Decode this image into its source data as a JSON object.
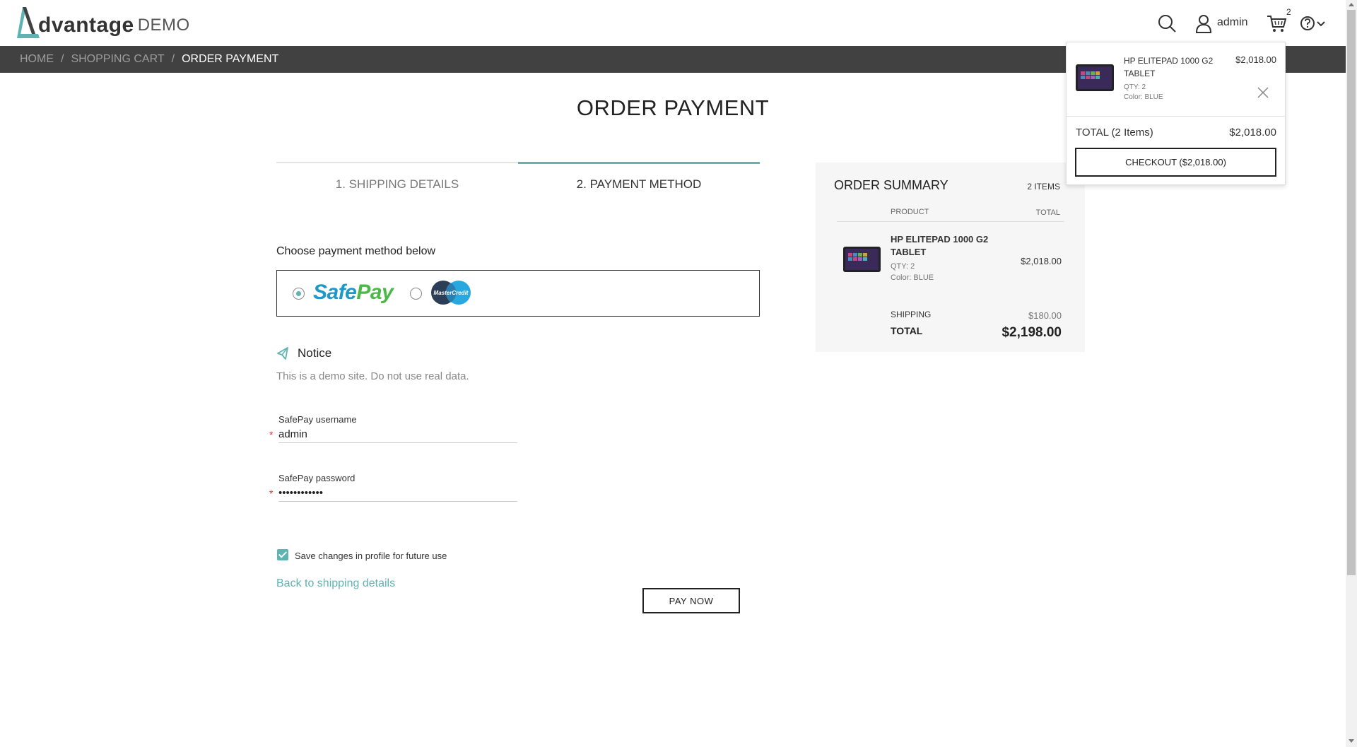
{
  "header": {
    "logo_word": "dvantage",
    "logo_demo": "DEMO",
    "user_label": "admin",
    "cart_count": "2"
  },
  "breadcrumb": {
    "items": [
      "HOME",
      "SHOPPING CART"
    ],
    "current": "ORDER PAYMENT"
  },
  "page": {
    "title": "ORDER PAYMENT"
  },
  "steps": [
    {
      "label": "1. SHIPPING DETAILS",
      "active": false
    },
    {
      "label": "2. PAYMENT METHOD",
      "active": true
    }
  ],
  "payment": {
    "choose_label": "Choose payment method below",
    "methods": [
      {
        "name_part1": "Safe",
        "name_part2": "Pay",
        "selected": true
      },
      {
        "name": "MasterCredit",
        "selected": false
      }
    ]
  },
  "notice": {
    "title": "Notice",
    "text": "This is a demo site. Do not use real data."
  },
  "form": {
    "username_label": "SafePay username",
    "username_value": "admin",
    "password_label": "SafePay password",
    "password_value": "••••••••••••",
    "required_mark": "*",
    "save_label": "Save changes in profile for future use",
    "save_checked": true
  },
  "actions": {
    "back_link": "Back to shipping details",
    "pay_now": "PAY NOW"
  },
  "summary": {
    "title": "ORDER SUMMARY",
    "count": "2 ITEMS",
    "col_product": "PRODUCT",
    "col_total": "TOTAL",
    "item": {
      "name": "HP ELITEPAD 1000 G2 TABLET",
      "qty": "QTY: 2",
      "color": "Color: BLUE",
      "price": "$2,018.00"
    },
    "shipping_label": "SHIPPING",
    "shipping_value": "$180.00",
    "total_label": "TOTAL",
    "total_value": "$2,198.00"
  },
  "cart_popup": {
    "item": {
      "name": "HP ELITEPAD 1000 G2 TABLET",
      "qty": "QTY: 2",
      "color": "Color: BLUE",
      "price": "$2,018.00"
    },
    "total_label": "TOTAL (2 Items)",
    "total_value": "$2,018.00",
    "checkout_label": "CHECKOUT ($2,018.00)"
  },
  "colors": {
    "accent": "#5fb3b3",
    "breadcrumb_bg": "#414141",
    "safepay_blue": "#1f97c8",
    "safepay_green": "#4bb848"
  },
  "icons": [
    "search-icon",
    "user-icon",
    "cart-icon",
    "help-icon",
    "chevron-down-icon",
    "notice-icon",
    "close-icon"
  ]
}
